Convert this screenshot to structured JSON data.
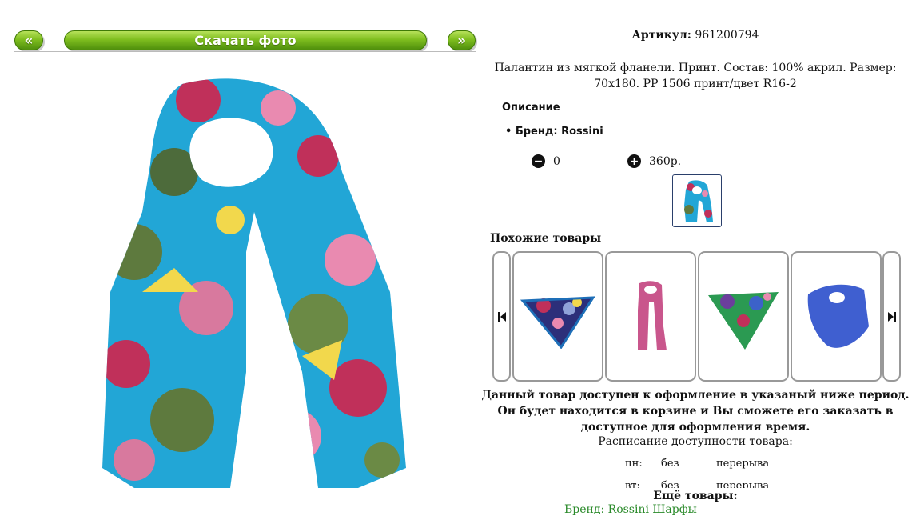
{
  "nav": {
    "prev_label": "«",
    "download_label": "Скачать фото",
    "next_label": "»"
  },
  "product": {
    "article_label": "Артикул:",
    "article_value": "961200794",
    "description": "Палантин из мягкой фланели. Принт. Состав: 100% акрил. Размер: 70x180. PP 1506 принт/цвет R16-2",
    "section_title": "Описание",
    "brand": "Бренд: Rossini",
    "quantity": "0",
    "price": "360р."
  },
  "similar": {
    "title": "Похожие товары",
    "items": [
      {
        "name": "navy-floral-scarf"
      },
      {
        "name": "pink-scarf"
      },
      {
        "name": "green-floral-scarf"
      },
      {
        "name": "blue-scarf"
      }
    ]
  },
  "availability": {
    "notice": "Данный товар доступен к оформление в указаный ниже период. Он будет находится в корзине и Вы сможете его заказать в доступное для оформления время.",
    "schedule_title": "Расписание доступности товара:",
    "rows": [
      {
        "day": "пн:",
        "from": "без",
        "to": "перерыва"
      },
      {
        "day": "вт:",
        "from": "без",
        "to": "перерыва"
      }
    ]
  },
  "more": {
    "title": "Ещё товары:",
    "link": "Бренд: Rossini Шарфы"
  },
  "colors": {
    "accent_green": "#7fbe1f",
    "scarf_blue": "#22a6d6",
    "link_green": "#2a8a2a"
  }
}
